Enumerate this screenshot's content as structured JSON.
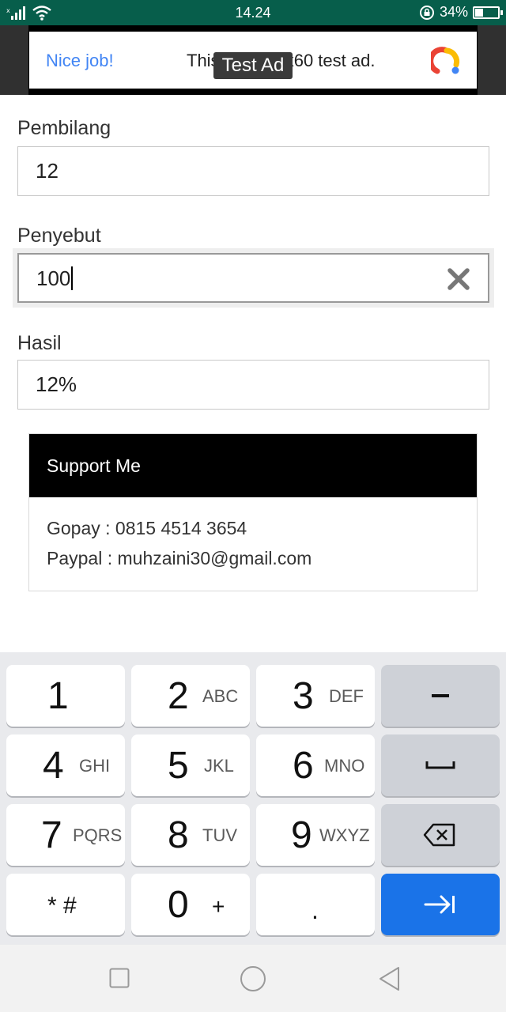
{
  "status_bar": {
    "time": "14.24",
    "battery_text": "34%",
    "battery_level": 0.34,
    "icons": [
      "no-sim-signal-icon",
      "wifi-icon",
      "rotation-lock-icon",
      "battery-icon"
    ]
  },
  "ad": {
    "badge": "Test Ad",
    "headline": "Nice job!",
    "body": "This is a 468x60 test ad.",
    "logo_icon": "ad-logo-icon",
    "headline_color": "#4285f4"
  },
  "form": {
    "numerator": {
      "label": "Pembilang",
      "value": "12"
    },
    "denominator": {
      "label": "Penyebut",
      "value": "100",
      "clear_icon": "close-icon"
    },
    "result": {
      "label": "Hasil",
      "value": "12%"
    }
  },
  "support": {
    "title": "Support Me",
    "lines": [
      "Gopay : 0815 4514 3654",
      "Paypal : muhzaini30@gmail.com"
    ]
  },
  "keyboard": {
    "keys": [
      {
        "main": "1",
        "sub": ""
      },
      {
        "main": "2",
        "sub": "ABC"
      },
      {
        "main": "3",
        "sub": "DEF"
      },
      {
        "main": "4",
        "sub": "GHI"
      },
      {
        "main": "5",
        "sub": "JKL"
      },
      {
        "main": "6",
        "sub": "MNO"
      },
      {
        "main": "7",
        "sub": "PQRS"
      },
      {
        "main": "8",
        "sub": "TUV"
      },
      {
        "main": "9",
        "sub": "WXYZ"
      },
      {
        "main": "0",
        "sub": "+"
      }
    ],
    "symbols_key": "* #",
    "period_key": ".",
    "function_icons": [
      "minus-icon",
      "space-icon",
      "backspace-icon",
      "next-tab-icon"
    ],
    "accent_color": "#1a73e8"
  },
  "nav_bar": {
    "icons": [
      "recent-apps-icon",
      "home-icon",
      "back-icon"
    ]
  },
  "colors": {
    "status_bar": "#075e4b",
    "card_header": "#000000"
  }
}
